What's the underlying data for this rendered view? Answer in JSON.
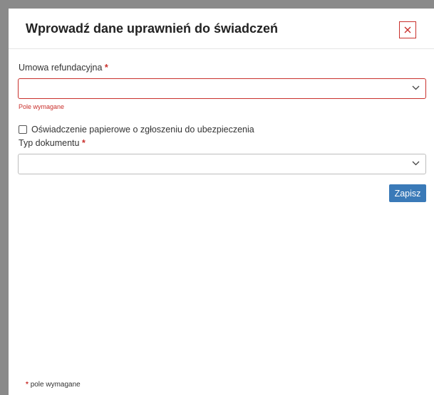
{
  "modal": {
    "title": "Wprowadź dane uprawnień do świadczeń",
    "close_symbol": "×"
  },
  "form": {
    "agreement_label": "Umowa refundacyjna",
    "required_mark": "*",
    "agreement_error": "Pole wymagane",
    "paper_declaration_label": "Oświadczenie papierowe o zgłoszeniu do ubezpieczenia",
    "document_type_label": "Typ dokumentu",
    "save_label": "Zapisz"
  },
  "footer": {
    "required_mark": "*",
    "note": "pole wymagane"
  },
  "colors": {
    "required": "#c9302c",
    "primary": "#3a7ab8"
  },
  "icons": [
    "close-icon",
    "chevron-down-icon"
  ]
}
